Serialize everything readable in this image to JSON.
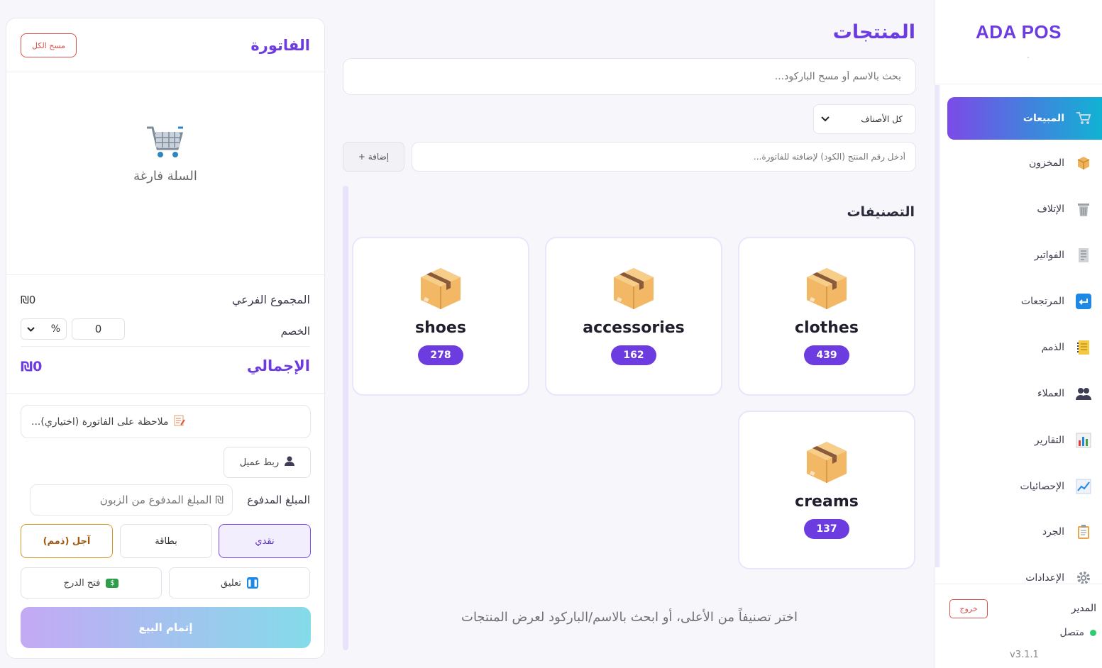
{
  "sidebar": {
    "brand": "ADA POS",
    "items": [
      {
        "label": "المبيعات",
        "icon": "cart-icon"
      },
      {
        "label": "المخزون",
        "icon": "box-icon"
      },
      {
        "label": "الإتلاف",
        "icon": "trash-icon"
      },
      {
        "label": "الفواتير",
        "icon": "invoice-icon"
      },
      {
        "label": "المرتجعات",
        "icon": "return-icon"
      },
      {
        "label": "الذمم",
        "icon": "notebook-icon"
      },
      {
        "label": "العملاء",
        "icon": "users-icon"
      },
      {
        "label": "التقارير",
        "icon": "bar-chart-icon"
      },
      {
        "label": "الإحصائيات",
        "icon": "line-chart-icon"
      },
      {
        "label": "الجرد",
        "icon": "clipboard-icon"
      },
      {
        "label": "الإعدادات",
        "icon": "gear-icon"
      }
    ],
    "user": "المدير",
    "logout_label": "خروج",
    "status": "متصل",
    "version": "v3.1.1"
  },
  "main": {
    "title": "المنتجات",
    "search_placeholder": "بحث بالاسم أو مسح الباركود...",
    "class_filter": "كل الأصناف",
    "code_placeholder": "أدخل رقم المنتج (الكود) لإضافته للفاتورة...",
    "add_label": "+ إضافة",
    "categories_title": "التصنيفات",
    "categories": [
      {
        "name": "clothes",
        "count": "439"
      },
      {
        "name": "accessories",
        "count": "162"
      },
      {
        "name": "shoes",
        "count": "278"
      },
      {
        "name": "creams",
        "count": "137"
      }
    ],
    "hint": "اختر تصنيفاً من الأعلى، أو ابحث بالاسم/الباركود لعرض المنتجات"
  },
  "invoice": {
    "title": "الفاتورة",
    "clear_label": "مسح الكل",
    "empty_text": "السلة فارغة",
    "subtotal_label": "المجموع الفرعي",
    "subtotal_value": "₪0",
    "discount_label": "الخصم",
    "discount_value": "0",
    "discount_type": "%",
    "total_label": "الإجمالي",
    "total_value": "₪0",
    "note_placeholder": "ملاحظة على الفاتورة (اختياري)...",
    "link_customer_label": "ربط عميل",
    "paid_label": "المبلغ المدفوع",
    "paid_placeholder": "₪ المبلغ المدفوع من الزبون",
    "pay_cash": "نقدي",
    "pay_card": "بطاقة",
    "pay_credit": "آجل (ذمم)",
    "hold_label": "تعليق",
    "drawer_label": "فتح الدرج",
    "complete_label": "إتمام البيع"
  },
  "colors": {
    "accent": "#6d3ce0",
    "gradient_start": "#7b4ae8",
    "gradient_end": "#10b3d4",
    "danger": "#d9534f",
    "online": "#2ecc71"
  }
}
